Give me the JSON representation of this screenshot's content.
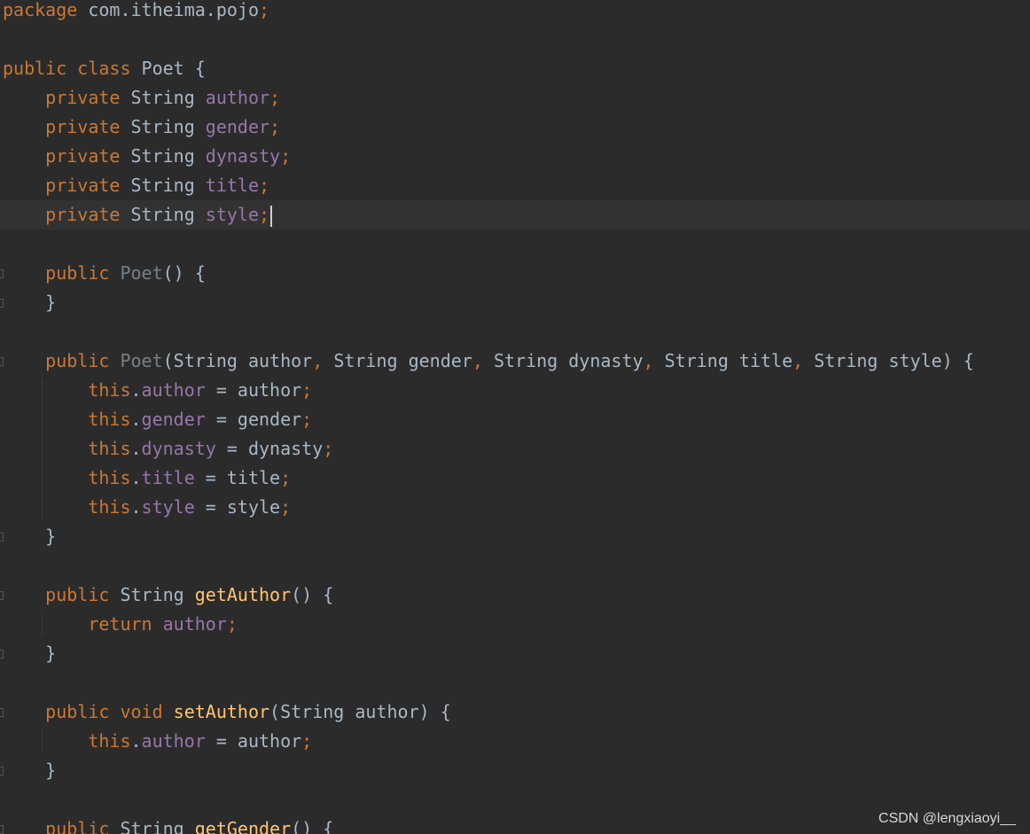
{
  "editor": {
    "theme": {
      "background": "#2b2b2b",
      "current_line": "#323232",
      "keyword": "#cc7832",
      "field": "#9876aa",
      "method": "#ffc66d",
      "text": "#a9b7c6"
    },
    "lines": [
      [
        [
          "kw",
          "package"
        ],
        [
          "id",
          " com.itheima.pojo"
        ],
        [
          "punct",
          ";"
        ]
      ],
      [],
      [
        [
          "kw",
          "public class "
        ],
        [
          "id",
          "Poet {"
        ]
      ],
      [
        [
          "id",
          "    "
        ],
        [
          "kw",
          "private "
        ],
        [
          "id",
          "String "
        ],
        [
          "field",
          "author"
        ],
        [
          "punct",
          ";"
        ]
      ],
      [
        [
          "id",
          "    "
        ],
        [
          "kw",
          "private "
        ],
        [
          "id",
          "String "
        ],
        [
          "field",
          "gender"
        ],
        [
          "punct",
          ";"
        ]
      ],
      [
        [
          "id",
          "    "
        ],
        [
          "kw",
          "private "
        ],
        [
          "id",
          "String "
        ],
        [
          "field",
          "dynasty"
        ],
        [
          "punct",
          ";"
        ]
      ],
      [
        [
          "id",
          "    "
        ],
        [
          "kw",
          "private "
        ],
        [
          "id",
          "String "
        ],
        [
          "field",
          "title"
        ],
        [
          "punct",
          ";"
        ]
      ],
      [
        [
          "id",
          "    "
        ],
        [
          "kw",
          "private "
        ],
        [
          "id",
          "String "
        ],
        [
          "field",
          "style"
        ],
        [
          "punct",
          ";"
        ]
      ],
      [],
      [
        [
          "id",
          "    "
        ],
        [
          "kw",
          "public "
        ],
        [
          "ctor",
          "Poet"
        ],
        [
          "id",
          "() {"
        ]
      ],
      [
        [
          "id",
          "    }"
        ]
      ],
      [],
      [
        [
          "id",
          "    "
        ],
        [
          "kw",
          "public "
        ],
        [
          "ctor",
          "Poet"
        ],
        [
          "id",
          "(String author"
        ],
        [
          "punct",
          ", "
        ],
        [
          "id",
          "String gender"
        ],
        [
          "punct",
          ", "
        ],
        [
          "id",
          "String dynasty"
        ],
        [
          "punct",
          ", "
        ],
        [
          "id",
          "String title"
        ],
        [
          "punct",
          ", "
        ],
        [
          "id",
          "String style) {"
        ]
      ],
      [
        [
          "id",
          "        "
        ],
        [
          "kw",
          "this"
        ],
        [
          "id",
          "."
        ],
        [
          "field",
          "author"
        ],
        [
          "id",
          " = author"
        ],
        [
          "punct",
          ";"
        ]
      ],
      [
        [
          "id",
          "        "
        ],
        [
          "kw",
          "this"
        ],
        [
          "id",
          "."
        ],
        [
          "field",
          "gender"
        ],
        [
          "id",
          " = gender"
        ],
        [
          "punct",
          ";"
        ]
      ],
      [
        [
          "id",
          "        "
        ],
        [
          "kw",
          "this"
        ],
        [
          "id",
          "."
        ],
        [
          "field",
          "dynasty"
        ],
        [
          "id",
          " = dynasty"
        ],
        [
          "punct",
          ";"
        ]
      ],
      [
        [
          "id",
          "        "
        ],
        [
          "kw",
          "this"
        ],
        [
          "id",
          "."
        ],
        [
          "field",
          "title"
        ],
        [
          "id",
          " = title"
        ],
        [
          "punct",
          ";"
        ]
      ],
      [
        [
          "id",
          "        "
        ],
        [
          "kw",
          "this"
        ],
        [
          "id",
          "."
        ],
        [
          "field",
          "style"
        ],
        [
          "id",
          " = style"
        ],
        [
          "punct",
          ";"
        ]
      ],
      [
        [
          "id",
          "    }"
        ]
      ],
      [],
      [
        [
          "id",
          "    "
        ],
        [
          "kw",
          "public "
        ],
        [
          "id",
          "String "
        ],
        [
          "method",
          "getAuthor"
        ],
        [
          "id",
          "() {"
        ]
      ],
      [
        [
          "id",
          "        "
        ],
        [
          "kw",
          "return "
        ],
        [
          "field",
          "author"
        ],
        [
          "punct",
          ";"
        ]
      ],
      [
        [
          "id",
          "    }"
        ]
      ],
      [],
      [
        [
          "id",
          "    "
        ],
        [
          "kw",
          "public void "
        ],
        [
          "method",
          "setAuthor"
        ],
        [
          "id",
          "(String author) {"
        ]
      ],
      [
        [
          "id",
          "        "
        ],
        [
          "kw",
          "this"
        ],
        [
          "id",
          "."
        ],
        [
          "field",
          "author"
        ],
        [
          "id",
          " = author"
        ],
        [
          "punct",
          ";"
        ]
      ],
      [
        [
          "id",
          "    }"
        ]
      ],
      [],
      [
        [
          "id",
          "    "
        ],
        [
          "kw",
          "public "
        ],
        [
          "id",
          "String "
        ],
        [
          "method",
          "getGender"
        ],
        [
          "id",
          "() {"
        ]
      ]
    ]
  },
  "watermark": {
    "text": "CSDN @lengxiaoyi__"
  }
}
